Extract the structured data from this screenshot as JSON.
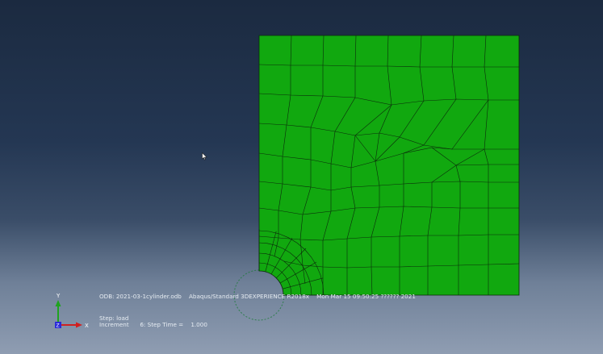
{
  "colors": {
    "mesh_fill": "#11a80f",
    "mesh_lines": "#0b2a0b",
    "hole_outline": "#1d7a3a",
    "triad_y": "#1fa31f",
    "triad_x": "#d12020",
    "triad_z": "#2b2bd8",
    "text": "#e6ecf2"
  },
  "info": {
    "odb_line": "ODB: 2021-03-1cylinder.odb    Abaqus/Standard 3DEXPERIENCE R2018x    Mon Mar 15 09:50:25 ?????? 2021",
    "step_line": "Step: load",
    "increment_line": "Increment      6: Step Time =    1.000"
  },
  "triad": {
    "y_label": "Y",
    "x_label": "X",
    "z_label": "Z"
  },
  "icons": {
    "cursor": "arrow-pointer-icon"
  }
}
